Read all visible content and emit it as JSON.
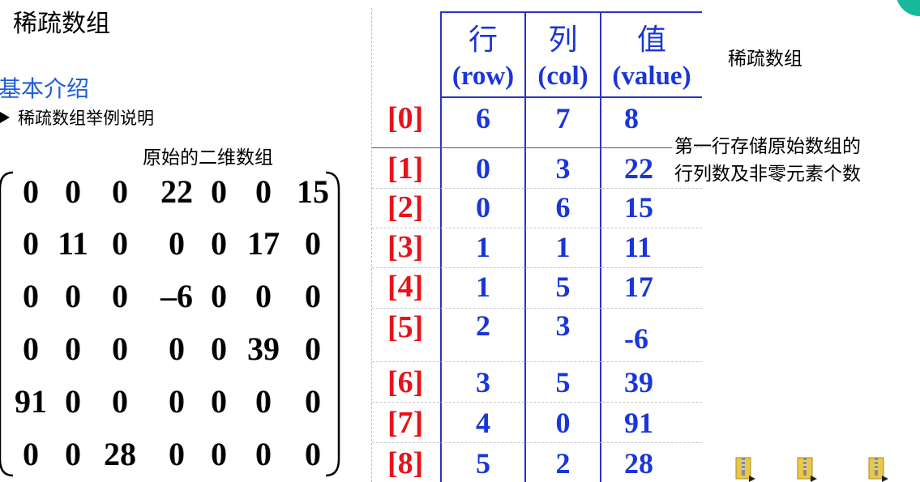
{
  "slide": {
    "title": "稀疏数组",
    "section": "基本介绍",
    "bullet": "稀疏数组举例说明",
    "matrix_label": "原始的二维数组",
    "note_top": "稀疏数组",
    "note_line1": "第一行存储原始数组的",
    "note_line2": "行列数及非零元素个数"
  },
  "matrix": [
    [
      "0",
      "0",
      "0",
      "22",
      "0",
      "0",
      "15"
    ],
    [
      "0",
      "11",
      "0",
      "0",
      "0",
      "17",
      "0"
    ],
    [
      "0",
      "0",
      "0",
      "–6",
      "0",
      "0",
      "0"
    ],
    [
      "0",
      "0",
      "0",
      "0",
      "0",
      "39",
      "0"
    ],
    [
      "91",
      "0",
      "0",
      "0",
      "0",
      "0",
      "0"
    ],
    [
      "0",
      "0",
      "28",
      "0",
      "0",
      "0",
      "0"
    ]
  ],
  "table": {
    "headers": [
      {
        "cn": "行",
        "en": "(row)"
      },
      {
        "cn": "列",
        "en": "(col)"
      },
      {
        "cn": "值",
        "en": "(value)"
      }
    ],
    "rows": [
      {
        "idx": "[0]",
        "row": "6",
        "col": "7",
        "value": "8"
      },
      {
        "idx": "[1]",
        "row": "0",
        "col": "3",
        "value": "22"
      },
      {
        "idx": "[2]",
        "row": "0",
        "col": "6",
        "value": "15"
      },
      {
        "idx": "[3]",
        "row": "1",
        "col": "1",
        "value": "11"
      },
      {
        "idx": "[4]",
        "row": "1",
        "col": "5",
        "value": "17"
      },
      {
        "idx": "[5]",
        "row": "2",
        "col": "3",
        "value": "-6"
      },
      {
        "idx": "[6]",
        "row": "3",
        "col": "5",
        "value": "39"
      },
      {
        "idx": "[7]",
        "row": "4",
        "col": "0",
        "value": "91"
      },
      {
        "idx": "[8]",
        "row": "5",
        "col": "2",
        "value": "28"
      }
    ]
  },
  "colors": {
    "index": "#e8121a",
    "table_text": "#1a35d8",
    "section": "#1f5fd6",
    "corner": "#17b89c"
  },
  "icons": [
    "zip-file-icon",
    "zip-file-icon",
    "zip-file-icon"
  ]
}
